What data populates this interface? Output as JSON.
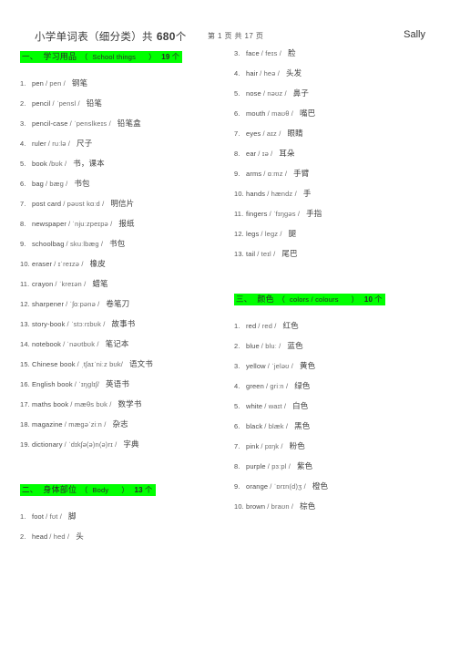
{
  "header": {
    "doc_title_cn": "小学单词表（细分类）共",
    "doc_title_count": "680",
    "doc_title_unit": "个",
    "page_indicator": "第 1 页 共 17 页",
    "author": "Sally"
  },
  "colors": {
    "section_bar_background": "#00ff00",
    "text": "#4a4a4a",
    "page_background": "#ffffff"
  },
  "sections": [
    {
      "index_cn": "一、",
      "title_cn": "学习用品",
      "paren_open": "（",
      "title_en": "School things",
      "paren_close": "）",
      "count": "19",
      "unit": "个",
      "column": "left",
      "entries": [
        {
          "num": "1.",
          "word": "pen",
          "phon": "/ pen /",
          "cn": "钢笔"
        },
        {
          "num": "2.",
          "word": "pencil",
          "phon": "/ ˈpensl /",
          "cn": "铅笔"
        },
        {
          "num": "3.",
          "word": "pencil-case",
          "phon": "/ ˈpenslkeɪs /",
          "cn": "铅笔盒"
        },
        {
          "num": "4.",
          "word": "ruler",
          "phon": "/ ruːlə /",
          "cn": "尺子"
        },
        {
          "num": "5.",
          "word": "book",
          "phon": "/bʊk /",
          "cn": "书，课本"
        },
        {
          "num": "6.",
          "word": "bag",
          "phon": "/ bæg /",
          "cn": "书包"
        },
        {
          "num": "7.",
          "word": "post card",
          "phon": "/ pəʊst kɑːd /",
          "cn": "明信片"
        },
        {
          "num": "8.",
          "word": "newspaper",
          "phon": "/ ˈnjuːzpeɪpə /",
          "cn": "报纸"
        },
        {
          "num": "9.",
          "word": "schoolbag",
          "phon": "/ skuːlbæg /",
          "cn": "书包"
        },
        {
          "num": "10.",
          "word": "eraser",
          "phon": "/ ɪˈreɪzə /",
          "cn": "橡皮"
        },
        {
          "num": "11.",
          "word": "crayon",
          "phon": "/ ˈkreɪən /",
          "cn": "蜡笔"
        },
        {
          "num": "12.",
          "word": "sharpener",
          "phon": "/ ˈʃɑːpənə /",
          "cn": "卷笔刀"
        },
        {
          "num": "13.",
          "word": "story-book",
          "phon": "/ ˈstɔːrɪbʊk /",
          "cn": "故事书"
        },
        {
          "num": "14.",
          "word": "notebook",
          "phon": "/ ˈnəʊtbʊk /",
          "cn": "笔记本"
        },
        {
          "num": "15.",
          "word": "Chinese book",
          "phon": "/ ˌtʃaɪˈniːz bʊk/",
          "cn": "语文书"
        },
        {
          "num": "16.",
          "word": "English book",
          "phon": "/ ˈɪŋglɪʃ/",
          "cn": "英语书"
        },
        {
          "num": "17.",
          "word": "maths book",
          "phon": "/ mæθs bʊk /",
          "cn": "数学书"
        },
        {
          "num": "18.",
          "word": "magazine",
          "phon": "/ mægəˈziːn /",
          "cn": "杂志"
        },
        {
          "num": "19.",
          "word": "dictionary",
          "phon": "/ ˈdɪkʃə(ə)n(ə)rɪ /",
          "cn": "字典"
        }
      ]
    },
    {
      "index_cn": "二、",
      "title_cn": "身体部位",
      "paren_open": "（",
      "title_en": "Body",
      "paren_close": "）",
      "count": "13",
      "unit": "个",
      "column": "split",
      "entries_left": [
        {
          "num": "1.",
          "word": "foot",
          "phon": "/ fʊt /",
          "cn": "脚"
        },
        {
          "num": "2.",
          "word": "head",
          "phon": "/ hed /",
          "cn": "头"
        }
      ],
      "entries_right": [
        {
          "num": "3.",
          "word": "face",
          "phon": "/ feɪs /",
          "cn": "脸"
        },
        {
          "num": "4.",
          "word": "hair",
          "phon": "/ heə /",
          "cn": "头发"
        },
        {
          "num": "5.",
          "word": "nose",
          "phon": "/ nəʊz /",
          "cn": "鼻子"
        },
        {
          "num": "6.",
          "word": "mouth",
          "phon": "/ maʊθ /",
          "cn": "嘴巴"
        },
        {
          "num": "7.",
          "word": "eyes",
          "phon": "/ aɪz /",
          "cn": "眼睛"
        },
        {
          "num": "8.",
          "word": "ear",
          "phon": "/ ɪə /",
          "cn": "耳朵"
        },
        {
          "num": "9.",
          "word": "arms",
          "phon": "/ ɑːmz /",
          "cn": "手臂"
        },
        {
          "num": "10.",
          "word": "hands",
          "phon": "/ hændz /",
          "cn": "手"
        },
        {
          "num": "11.",
          "word": "fingers",
          "phon": "/ ˈfɪŋgəs /",
          "cn": "手指"
        },
        {
          "num": "12.",
          "word": "legs",
          "phon": "/ legz /",
          "cn": "腿"
        },
        {
          "num": "13.",
          "word": "tail",
          "phon": "/ teɪl /",
          "cn": "尾巴"
        }
      ]
    },
    {
      "index_cn": "三、",
      "title_cn": "颜色",
      "paren_open": "（",
      "title_en": "colors / colours",
      "paren_close": "）",
      "count": "10",
      "unit": "个",
      "column": "right",
      "entries": [
        {
          "num": "1.",
          "word": "red",
          "phon": "/ red /",
          "cn": "红色"
        },
        {
          "num": "2.",
          "word": "blue",
          "phon": "/ bluː /",
          "cn": "蓝色"
        },
        {
          "num": "3.",
          "word": "yellow",
          "phon": "/ ˈjeləʊ /",
          "cn": "黄色"
        },
        {
          "num": "4.",
          "word": "green",
          "phon": "/ griːn /",
          "cn": "绿色"
        },
        {
          "num": "5.",
          "word": "white",
          "phon": "/ waɪt /",
          "cn": "白色"
        },
        {
          "num": "6.",
          "word": "black",
          "phon": "/ blæk /",
          "cn": "黑色"
        },
        {
          "num": "7.",
          "word": "pink",
          "phon": "/ pɪŋk /",
          "cn": "粉色"
        },
        {
          "num": "8.",
          "word": "purple",
          "phon": "/ pɜːpl /",
          "cn": "紫色"
        },
        {
          "num": "9.",
          "word": "orange",
          "phon": "/ ˈɒrɪn(d)ʒ /",
          "cn": "橙色"
        },
        {
          "num": "10.",
          "word": "brown",
          "phon": "/ braʊn /",
          "cn": "棕色"
        }
      ]
    }
  ]
}
